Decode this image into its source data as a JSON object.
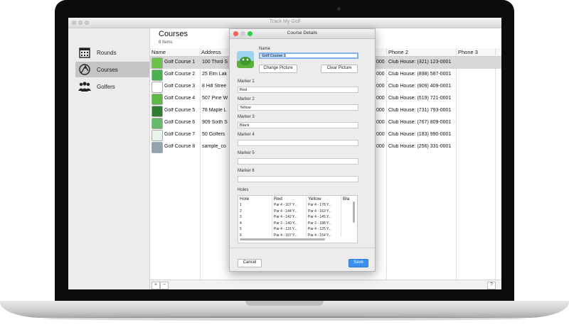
{
  "window": {
    "title": "Track My Golf"
  },
  "sidebar": {
    "items": [
      {
        "label": "Rounds",
        "icon": "calendar-icon"
      },
      {
        "label": "Courses",
        "icon": "course-icon"
      },
      {
        "label": "Golfers",
        "icon": "people-icon"
      }
    ],
    "selected": "Courses"
  },
  "list": {
    "title": "Courses",
    "count": "8 Items",
    "columns": [
      "Name",
      "Address",
      "Phone 2",
      "Phone 3"
    ],
    "rows": [
      {
        "name": "Golf Course 1",
        "address": "100 Third S",
        "phone_prefix": "000",
        "phone2": "Club House: (321) 123-0001"
      },
      {
        "name": "Golf Course 2",
        "address": "25 Elm Lak",
        "phone_prefix": "000",
        "phone2": "Club House: (898) 587-0001"
      },
      {
        "name": "Golf Course 3",
        "address": "8 Hill Stree",
        "phone_prefix": "000",
        "phone2": "Club House: (909) 409-0001"
      },
      {
        "name": "Golf Course 4",
        "address": "507 Pine W",
        "phone_prefix": "000",
        "phone2": "Club House: (519) 721-0001"
      },
      {
        "name": "Golf Course 5",
        "address": "78 Maple L",
        "phone_prefix": "000",
        "phone2": "Club House: (731) 793-0001"
      },
      {
        "name": "Golf Course 6",
        "address": "909 Sixth S",
        "phone_prefix": "000",
        "phone2": "Club House: (767) 809-0001"
      },
      {
        "name": "Golf Course 7",
        "address": "50 Golfers",
        "phone_prefix": "000",
        "phone2": "Club House: (183) 990-0001"
      },
      {
        "name": "Golf Course 8",
        "address": "sample_co",
        "phone_prefix": "000",
        "phone2": "Club House: (256) 331-0001"
      }
    ],
    "add_label": "+",
    "remove_label": "−",
    "help_label": "?"
  },
  "dialog": {
    "title": "Course Details",
    "name_label": "Name",
    "name_value": "Golf Course 1",
    "change_picture": "Change Picture",
    "clear_picture": "Clear Picture",
    "markers": [
      {
        "label": "Marker 1",
        "value": "Red"
      },
      {
        "label": "Marker 2",
        "value": "Yellow"
      },
      {
        "label": "Marker 3",
        "value": "Black"
      },
      {
        "label": "Marker 4",
        "value": ""
      },
      {
        "label": "Marker 5",
        "value": ""
      },
      {
        "label": "Marker 6",
        "value": ""
      }
    ],
    "holes_label": "Holes",
    "holes_columns": [
      "Hole",
      "Red",
      "Yellow",
      "Bla"
    ],
    "holes_rows": [
      {
        "hole": "1",
        "red": "Par 4 - 107 Y...",
        "yellow": "Par 4 - 178 Y..."
      },
      {
        "hole": "2",
        "red": "Par 4 - 144 Y...",
        "yellow": "Par 4 - 163 Y..."
      },
      {
        "hole": "3",
        "red": "Par 4 - 142 Y...",
        "yellow": "Par 4 - 145 Y..."
      },
      {
        "hole": "4",
        "red": "Par 3 - 140 Y...",
        "yellow": "Par 3 - 188 Y..."
      },
      {
        "hole": "5",
        "red": "Par 4 - 110 Y...",
        "yellow": "Par 4 - 125 Y..."
      },
      {
        "hole": "6",
        "red": "Par 4 - 107 Y...",
        "yellow": "Par 4 - 154 Y..."
      }
    ],
    "cancel": "Cancel",
    "save": "Save"
  },
  "colors": {
    "accent": "#3b8ff3",
    "close": "#fc605c",
    "minimize": "#fdbc40",
    "zoom": "#34c84a"
  }
}
